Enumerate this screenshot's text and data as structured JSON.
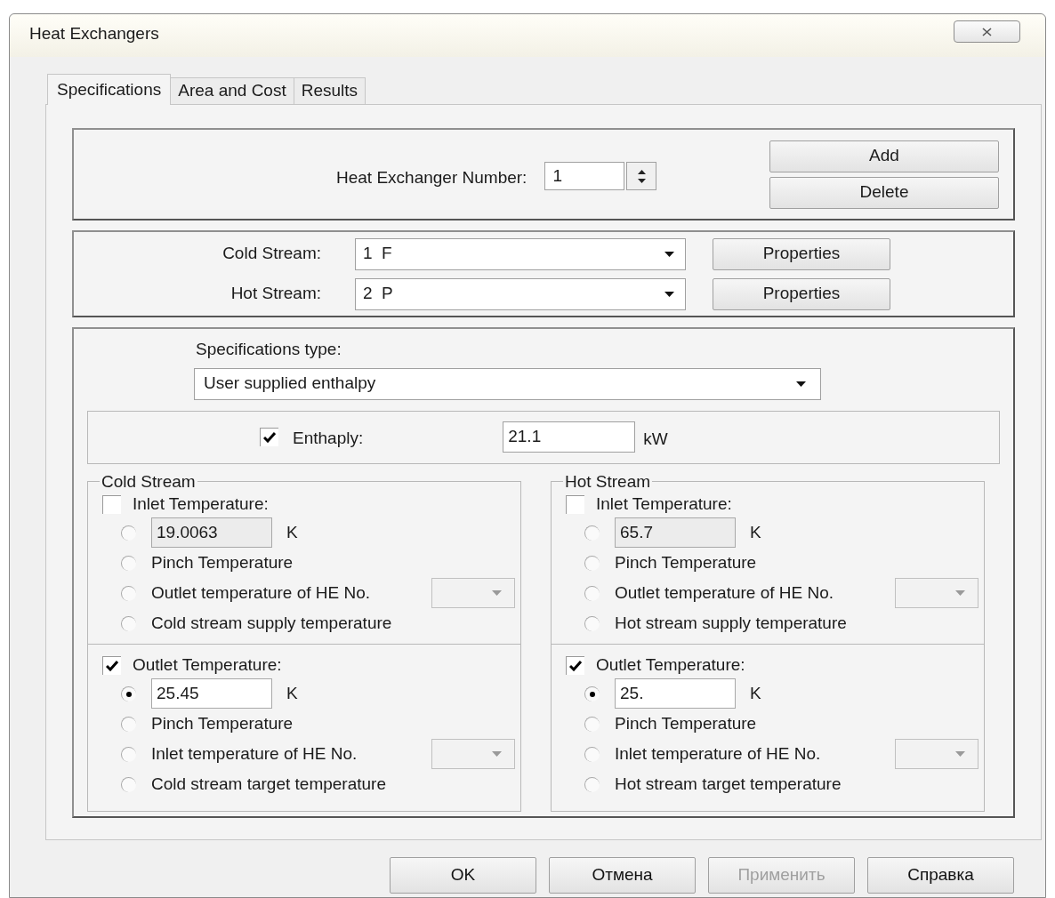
{
  "window": {
    "title": "Heat Exchangers"
  },
  "tabs": [
    {
      "label": "Specifications",
      "selected": true
    },
    {
      "label": "Area and Cost",
      "selected": false
    },
    {
      "label": "Results",
      "selected": false
    }
  ],
  "exchanger": {
    "label": "Heat Exchanger Number:",
    "value": "1",
    "buttons": [
      "Add",
      "Delete"
    ]
  },
  "streams": [
    {
      "label": "Cold Stream:",
      "value": "1  F",
      "button": "Properties"
    },
    {
      "label": "Hot Stream:",
      "value": "2  P",
      "button": "Properties"
    }
  ],
  "specifications_type": {
    "label": "Specifications type:",
    "value": "User supplied enthalpy"
  },
  "enthalpy": {
    "checked": true,
    "label": "Enthaply:",
    "value": "21.1",
    "unit": "kW"
  },
  "groups": [
    {
      "title": "Cold Stream",
      "sections": [
        {
          "checked": false,
          "label": "Inlet Temperature:",
          "options": [
            {
              "kind": "value",
              "selected": false,
              "value": "19.0063",
              "unit": "K"
            },
            {
              "kind": "text",
              "selected": false,
              "label": "Pinch Temperature"
            },
            {
              "kind": "combo",
              "selected": false,
              "label": "Outlet temperature of HE No."
            },
            {
              "kind": "text",
              "selected": false,
              "label": "Cold stream supply temperature"
            }
          ]
        },
        {
          "checked": true,
          "label": "Outlet Temperature:",
          "options": [
            {
              "kind": "value",
              "selected": true,
              "value": "25.45",
              "unit": "K"
            },
            {
              "kind": "text",
              "selected": false,
              "label": "Pinch Temperature"
            },
            {
              "kind": "combo",
              "selected": false,
              "label": "Inlet temperature of HE No."
            },
            {
              "kind": "text",
              "selected": false,
              "label": "Cold stream target temperature"
            }
          ]
        }
      ]
    },
    {
      "title": "Hot Stream",
      "sections": [
        {
          "checked": false,
          "label": "Inlet Temperature:",
          "options": [
            {
              "kind": "value",
              "selected": false,
              "value": "65.7",
              "unit": "K"
            },
            {
              "kind": "text",
              "selected": false,
              "label": "Pinch Temperature"
            },
            {
              "kind": "combo",
              "selected": false,
              "label": "Outlet temperature of HE No."
            },
            {
              "kind": "text",
              "selected": false,
              "label": "Hot stream supply temperature"
            }
          ]
        },
        {
          "checked": true,
          "label": "Outlet Temperature:",
          "options": [
            {
              "kind": "value",
              "selected": true,
              "value": "25.",
              "unit": "K"
            },
            {
              "kind": "text",
              "selected": false,
              "label": "Pinch Temperature"
            },
            {
              "kind": "combo",
              "selected": false,
              "label": "Inlet temperature of HE No."
            },
            {
              "kind": "text",
              "selected": false,
              "label": "Hot stream target temperature"
            }
          ]
        }
      ]
    }
  ],
  "buttons": [
    {
      "label": "OK",
      "disabled": false
    },
    {
      "label": "Отмена",
      "disabled": false
    },
    {
      "label": "Применить",
      "disabled": true
    },
    {
      "label": "Справка",
      "disabled": false
    }
  ]
}
